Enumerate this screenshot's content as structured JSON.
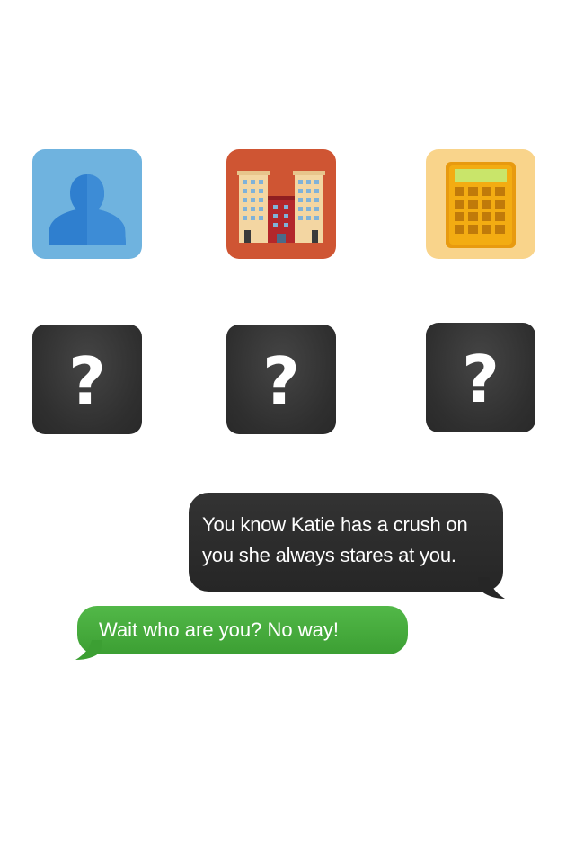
{
  "icons": [
    {
      "name": "contact-person-icon",
      "color": "#6fb3df"
    },
    {
      "name": "building-icon",
      "color": "#cf5533"
    },
    {
      "name": "calculator-icon",
      "color": "#f9d48b"
    }
  ],
  "unknown_tiles": [
    {
      "label": "?"
    },
    {
      "label": "?"
    },
    {
      "label": "?"
    }
  ],
  "messages": [
    {
      "direction": "incoming",
      "lines": [
        "You know Katie has a crush on",
        "you she always stares at you."
      ],
      "color": "#2b2b2b"
    },
    {
      "direction": "outgoing",
      "lines": [
        "Wait who are you? No way!"
      ],
      "color": "#46a93c"
    }
  ]
}
